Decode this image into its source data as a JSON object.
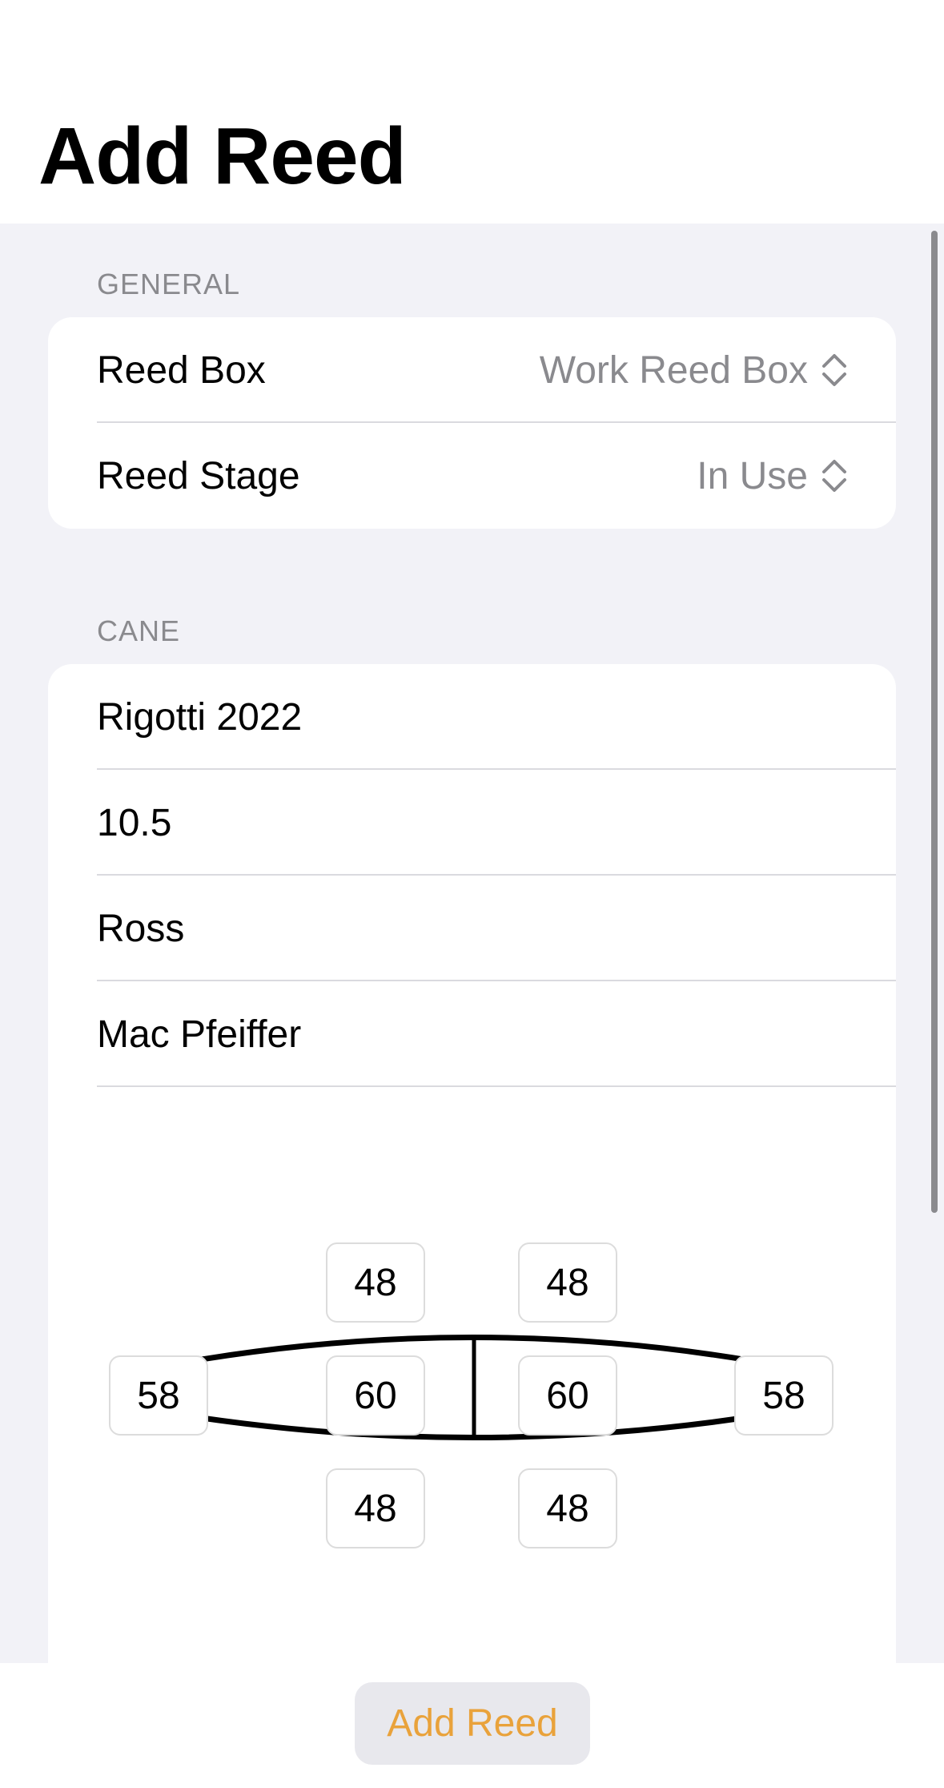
{
  "header": {
    "title": "Add Reed"
  },
  "general": {
    "header": "GENERAL",
    "rows": [
      {
        "label": "Reed Box",
        "value": "Work Reed Box",
        "icon": "chevron-up-down-icon"
      },
      {
        "label": "Reed Stage",
        "value": "In Use",
        "icon": "chevron-up-down-icon"
      }
    ]
  },
  "cane": {
    "header": "CANE",
    "fields": [
      "Rigotti 2022",
      "10.5",
      "Ross",
      "Mac Pfeiffer"
    ],
    "measurements": {
      "top_left": "48",
      "top_right": "48",
      "left_tip": "58",
      "center_left": "60",
      "center_right": "60",
      "right_tip": "58",
      "bottom_left": "48",
      "bottom_right": "48"
    }
  },
  "footer": {
    "add_button_label": "Add Reed"
  },
  "colors": {
    "accent": "#e9a23b",
    "background": "#f2f2f7",
    "secondary_text": "#8a8a8e"
  }
}
